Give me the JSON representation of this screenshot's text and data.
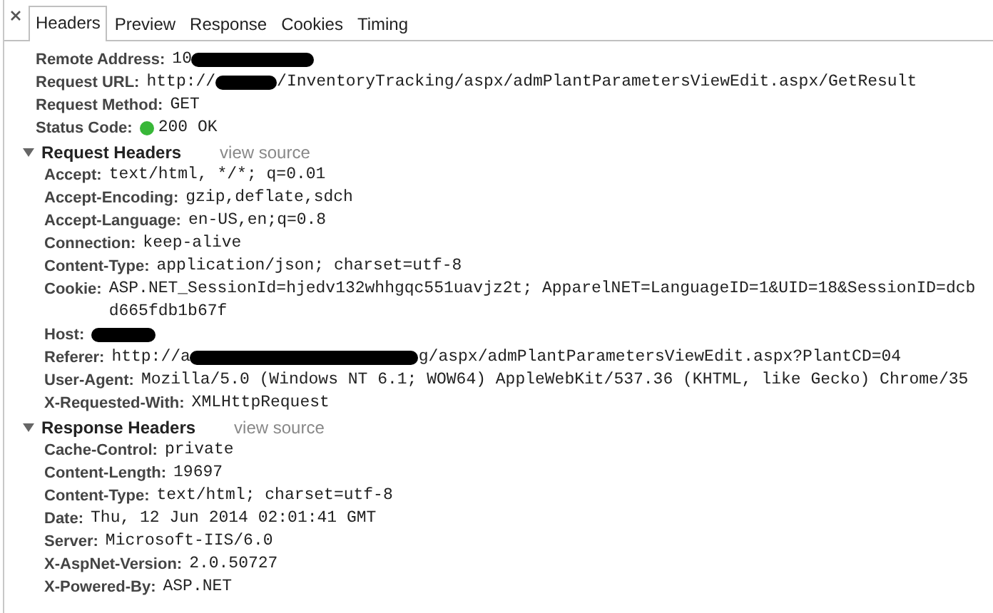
{
  "tabs": [
    {
      "label": "Headers",
      "selected": true
    },
    {
      "label": "Preview",
      "selected": false
    },
    {
      "label": "Response",
      "selected": false
    },
    {
      "label": "Cookies",
      "selected": false
    },
    {
      "label": "Timing",
      "selected": false
    }
  ],
  "general": [
    {
      "name": "Remote Address:",
      "value": [
        {
          "kind": "text",
          "text": "10"
        },
        {
          "kind": "redacted"
        }
      ]
    },
    {
      "name": "Request URL:",
      "value": [
        {
          "kind": "text",
          "text": "http://"
        },
        {
          "kind": "redacted"
        },
        {
          "kind": "text",
          "text": "/InventoryTracking/aspx/admPlantParametersViewEdit.aspx/GetResult"
        }
      ]
    },
    {
      "name": "Request Method:",
      "value": [
        {
          "kind": "text",
          "text": "GET"
        }
      ]
    },
    {
      "name": "Status Code:",
      "value": [
        {
          "kind": "dot",
          "color": "#38b738"
        },
        {
          "kind": "text",
          "text": "200 OK"
        }
      ]
    }
  ],
  "sections": [
    {
      "title": "Request Headers",
      "link": "view source",
      "expanded": true,
      "headers": [
        {
          "name": "Accept:",
          "value": [
            {
              "kind": "text",
              "text": "text/html, */*; q=0.01"
            }
          ]
        },
        {
          "name": "Accept-Encoding:",
          "value": [
            {
              "kind": "text",
              "text": "gzip,deflate,sdch"
            }
          ]
        },
        {
          "name": "Accept-Language:",
          "value": [
            {
              "kind": "text",
              "text": "en-US,en;q=0.8"
            }
          ]
        },
        {
          "name": "Connection:",
          "value": [
            {
              "kind": "text",
              "text": "keep-alive"
            }
          ]
        },
        {
          "name": "Content-Type:",
          "value": [
            {
              "kind": "text",
              "text": "application/json; charset=utf-8"
            }
          ]
        },
        {
          "name": "Cookie:",
          "value": [
            {
              "kind": "text",
              "text": "ASP.NET_SessionId=hjedv132whhgqc551uavjz2t; ApparelNET=LanguageID=1&UID=18&SessionID=dcb"
            },
            {
              "kind": "break"
            },
            {
              "kind": "text",
              "text": "d665fdb1b67f"
            }
          ]
        },
        {
          "name": "Host:",
          "value": [
            {
              "kind": "redacted"
            }
          ]
        },
        {
          "name": "Referer:",
          "value": [
            {
              "kind": "text",
              "text": "http://a"
            },
            {
              "kind": "redacted"
            },
            {
              "kind": "text",
              "text": "g/aspx/admPlantParametersViewEdit.aspx?PlantCD=04"
            }
          ]
        },
        {
          "name": "User-Agent:",
          "value": [
            {
              "kind": "text",
              "text": "Mozilla/5.0 (Windows NT 6.1; WOW64) AppleWebKit/537.36 (KHTML, like Gecko) Chrome/35"
            }
          ]
        },
        {
          "name": "X-Requested-With:",
          "value": [
            {
              "kind": "text",
              "text": "XMLHttpRequest"
            }
          ]
        }
      ]
    },
    {
      "title": "Response Headers",
      "link": "view source",
      "expanded": true,
      "headers": [
        {
          "name": "Cache-Control:",
          "value": [
            {
              "kind": "text",
              "text": "private"
            }
          ]
        },
        {
          "name": "Content-Length:",
          "value": [
            {
              "kind": "text",
              "text": "19697"
            }
          ]
        },
        {
          "name": "Content-Type:",
          "value": [
            {
              "kind": "text",
              "text": "text/html; charset=utf-8"
            }
          ]
        },
        {
          "name": "Date:",
          "value": [
            {
              "kind": "text",
              "text": "Thu, 12 Jun 2014 02:01:41 GMT"
            }
          ]
        },
        {
          "name": "Server:",
          "value": [
            {
              "kind": "text",
              "text": "Microsoft-IIS/6.0"
            }
          ]
        },
        {
          "name": "X-AspNet-Version:",
          "value": [
            {
              "kind": "text",
              "text": "2.0.50727"
            }
          ]
        },
        {
          "name": "X-Powered-By:",
          "value": [
            {
              "kind": "text",
              "text": "ASP.NET"
            }
          ]
        }
      ]
    }
  ]
}
